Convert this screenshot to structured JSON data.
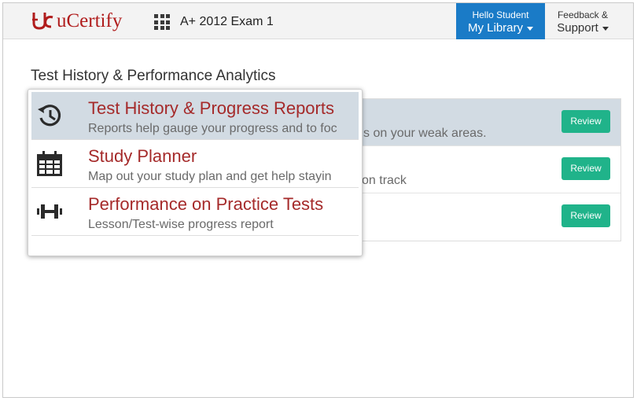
{
  "brand": {
    "name": "uCertify",
    "accent": "#b01c1c"
  },
  "header": {
    "course_title": "A+ 2012 Exam 1",
    "library": {
      "greeting": "Hello Student",
      "label": "My Library"
    },
    "support": {
      "line1": "Feedback &",
      "line2": "Support"
    }
  },
  "page": {
    "title": "Test History & Performance Analytics"
  },
  "rows": [
    {
      "review_label": "Review",
      "active": true
    },
    {
      "review_label": "Review"
    },
    {
      "review_label": "Review"
    }
  ],
  "menu": {
    "items": [
      {
        "icon": "history-icon",
        "title": "Test History & Progress Reports",
        "subtitle": "Reports help gauge your progress and to focus on your weak areas.",
        "visible_subtitle": "Reports help gauge your progress and to foc",
        "spill": "s on your weak areas."
      },
      {
        "icon": "calendar-icon",
        "title": "Study Planner",
        "subtitle": "Map out your study plan and get help staying on track",
        "visible_subtitle": "Map out your study plan and get help stayin",
        "spill": "on track"
      },
      {
        "icon": "dumbbell-icon",
        "title": "Performance on Practice Tests",
        "subtitle": "Lesson/Test-wise progress report"
      }
    ]
  },
  "colors": {
    "primary": "#1a7bc7",
    "review_button": "#20b38a",
    "menu_title": "#a52a2a",
    "active_row": "#d2dbe3"
  }
}
